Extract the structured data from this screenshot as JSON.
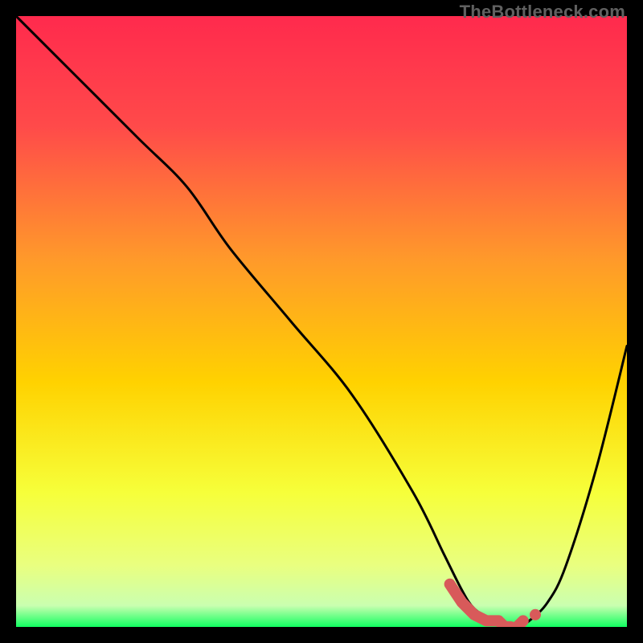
{
  "watermark": "TheBottleneck.com",
  "chart_data": {
    "type": "line",
    "title": "",
    "xlabel": "",
    "ylabel": "",
    "xlim": [
      0,
      100
    ],
    "ylim": [
      0,
      100
    ],
    "grid": false,
    "series": [
      {
        "name": "curve",
        "color": "#000000",
        "x": [
          0,
          10,
          20,
          28,
          35,
          45,
          55,
          65,
          70,
          73,
          75,
          78,
          80,
          82,
          84,
          87,
          90,
          95,
          100
        ],
        "values": [
          100,
          90,
          80,
          72,
          62,
          50,
          38,
          22,
          12,
          6,
          3,
          1,
          0,
          0,
          1,
          4,
          10,
          26,
          46
        ]
      },
      {
        "name": "marker-segment",
        "color": "#d85a5a",
        "style": "thick-dash",
        "x": [
          71,
          73,
          75,
          77,
          79,
          80,
          81,
          82,
          83,
          85
        ],
        "values": [
          7,
          4,
          2,
          1,
          1,
          0,
          0,
          0,
          1,
          2
        ]
      }
    ],
    "background_gradient": {
      "stops": [
        {
          "offset": 0.0,
          "color": "#ff2a4d"
        },
        {
          "offset": 0.18,
          "color": "#ff4a4a"
        },
        {
          "offset": 0.4,
          "color": "#ff9a2a"
        },
        {
          "offset": 0.6,
          "color": "#ffd200"
        },
        {
          "offset": 0.78,
          "color": "#f6ff3a"
        },
        {
          "offset": 0.9,
          "color": "#e9ff80"
        },
        {
          "offset": 0.965,
          "color": "#caffb0"
        },
        {
          "offset": 1.0,
          "color": "#10ff60"
        }
      ]
    }
  }
}
